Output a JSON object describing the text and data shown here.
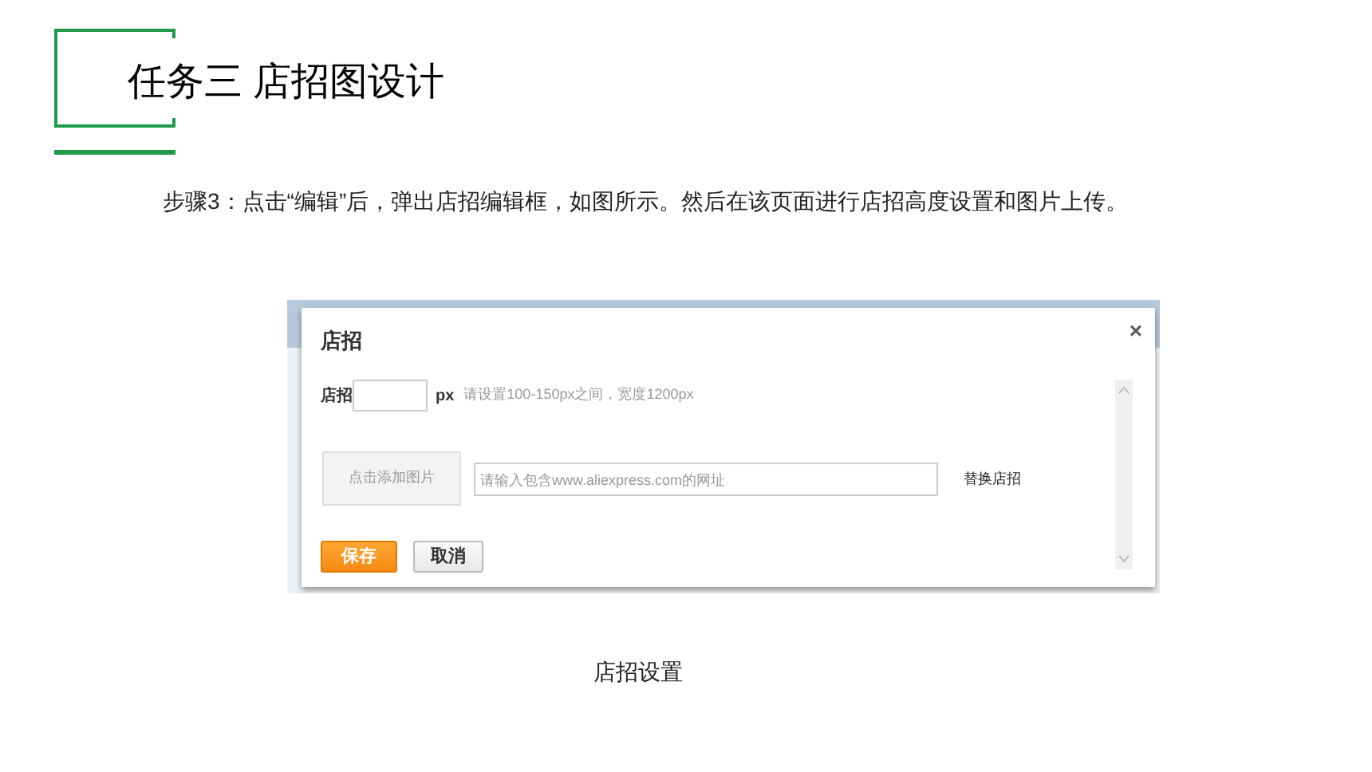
{
  "slide_title": "任务三 店招图设计",
  "instruction": "步骤3：点击“编辑”后，弹出店招编辑框，如图所示。然后在该页面进行店招高度设置和图片上传。",
  "dialog": {
    "title": "店招",
    "close": "×",
    "height_label": "店招",
    "height_unit": "px",
    "height_hint": "请设置100-150px之间，宽度1200px",
    "add_image_button": "点击添加图片",
    "url_field": {
      "placeholder": "请输入包含www.aliexpress.com的网址"
    },
    "replace_link": "替换店招",
    "buttons": [
      {
        "label": "保存",
        "kind": "primary"
      },
      {
        "label": "取消",
        "kind": "secondary"
      }
    ]
  },
  "caption": "店招设置"
}
